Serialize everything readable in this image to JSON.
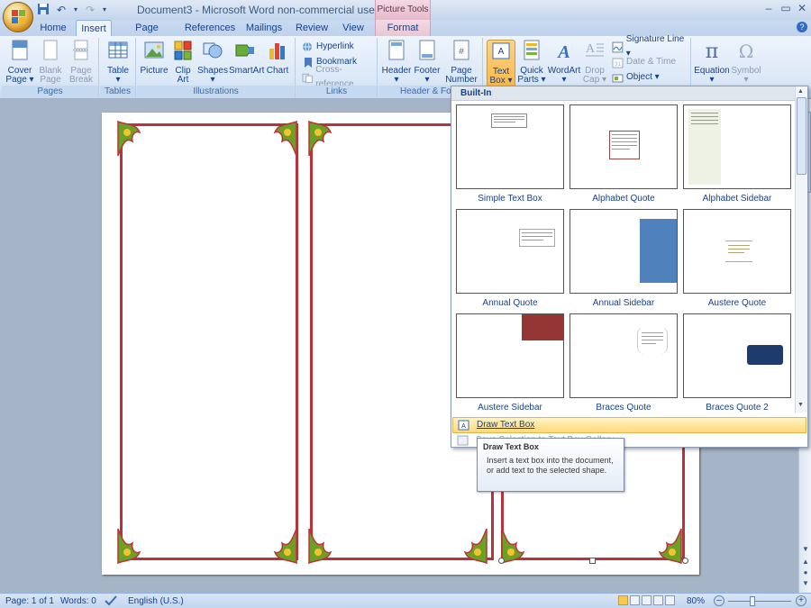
{
  "window": {
    "title": "Document3 - Microsoft Word non-commercial use",
    "context_tab_group": "Picture Tools",
    "controls": {
      "minimize": "–",
      "restore": "▭",
      "close": "✕"
    }
  },
  "tabs": [
    "Home",
    "Insert",
    "Page Layout",
    "References",
    "Mailings",
    "Review",
    "View",
    "Format"
  ],
  "active_tab": "Insert",
  "ribbon": {
    "groups": {
      "pages": {
        "label": "Pages",
        "buttons": [
          "Cover Page",
          "Blank Page",
          "Page Break"
        ]
      },
      "tables": {
        "label": "Tables",
        "buttons": [
          "Table"
        ]
      },
      "illustrations": {
        "label": "Illustrations",
        "buttons": [
          "Picture",
          "Clip Art",
          "Shapes",
          "SmartArt",
          "Chart"
        ]
      },
      "links": {
        "label": "Links",
        "buttons": [
          "Hyperlink",
          "Bookmark",
          "Cross-reference"
        ]
      },
      "header_footer": {
        "label": "Header & Foo",
        "buttons": [
          "Header",
          "Footer",
          "Page Number"
        ]
      },
      "text": {
        "buttons": [
          "Text Box",
          "Quick Parts",
          "WordArt",
          "Drop Cap"
        ],
        "side": [
          "Signature Line",
          "Date & Time",
          "Object"
        ]
      },
      "symbols": {
        "buttons": [
          "Equation",
          "Symbol"
        ]
      }
    },
    "labels": {
      "cover_1": "Cover",
      "cover_2": "Page ▾",
      "blank_1": "Blank",
      "blank_2": "Page",
      "break_1": "Page",
      "break_2": "Break",
      "table_1": "Table",
      "table_2": "▾",
      "picture": "Picture",
      "clip_1": "Clip",
      "clip_2": "Art",
      "shapes_1": "Shapes",
      "shapes_2": "▾",
      "smartart": "SmartArt",
      "chart": "Chart",
      "header_1": "Header",
      "header_2": "▾",
      "footer_1": "Footer",
      "footer_2": "▾",
      "pagenum_1": "Page",
      "pagenum_2": "Number ▾",
      "textbox_1": "Text",
      "textbox_2": "Box ▾",
      "quick_1": "Quick",
      "quick_2": "Parts ▾",
      "wordart_1": "WordArt",
      "wordart_2": "▾",
      "dropcap_1": "Drop",
      "dropcap_2": "Cap ▾",
      "signature": "Signature Line ▾",
      "datetime": "Date & Time",
      "object": "Object ▾",
      "equation_1": "Equation",
      "equation_2": "▾",
      "symbol_1": "Symbol",
      "symbol_2": "▾"
    }
  },
  "gallery": {
    "header": "Built-In",
    "items": [
      "Simple Text Box",
      "Alphabet Quote",
      "Alphabet Sidebar",
      "Annual Quote",
      "Annual Sidebar",
      "Austere Quote",
      "Austere Sidebar",
      "Braces Quote",
      "Braces Quote 2"
    ],
    "draw_text_box": "Draw Text Box",
    "save_selection": "Save Selection to Text Box Gallery"
  },
  "tooltip": {
    "title": "Draw Text Box",
    "body": "Insert a text box into the document, or add text to the selected shape."
  },
  "status": {
    "page": "Page: 1 of 1",
    "words": "Words: 0",
    "language": "English (U.S.)",
    "zoom": "80%",
    "zoom_minus": "–",
    "zoom_plus": "+"
  },
  "colors": {
    "border_red": "#b8343a",
    "accent_blue": "#15428b",
    "annual_sidebar_blue": "#4f81bd",
    "austere_sidebar_red": "#943634",
    "braces_quote2_navy": "#1f3b6e"
  }
}
